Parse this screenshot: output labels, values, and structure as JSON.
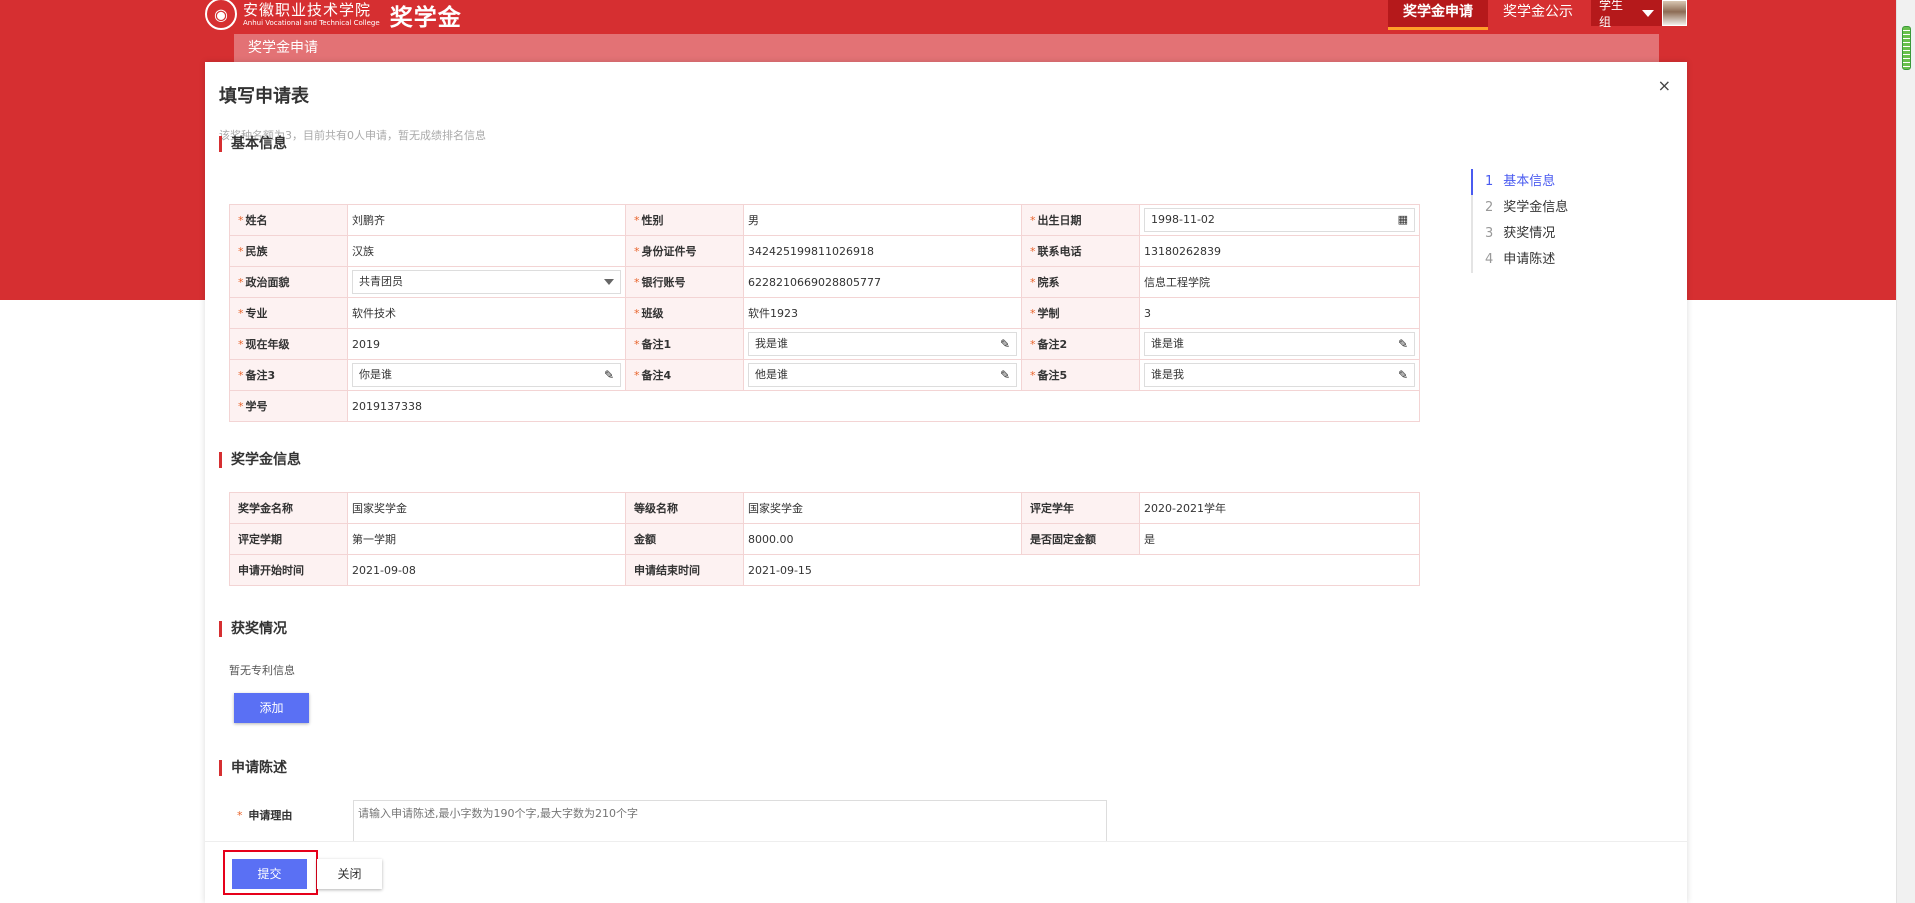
{
  "header": {
    "school_name_cn": "安徽职业技术学院",
    "school_name_en": "Anhui Vocational and Technical College",
    "app_title": "奖学金",
    "nav": [
      {
        "label": "奖学金申请",
        "active": true
      },
      {
        "label": "奖学金公示",
        "active": false
      }
    ],
    "user_name": "学生组"
  },
  "subheader": "奖学金申请",
  "modal": {
    "title": "填写申请表",
    "close": "×",
    "hint": "该奖种名额为3，目前共有0人申请，暂无成绩排名信息"
  },
  "basic": {
    "section_title": "基本信息",
    "name_label": "姓名",
    "name": "刘鹏齐",
    "gender_label": "性别",
    "gender": "男",
    "birth_label": "出生日期",
    "birth": "1998-11-02",
    "ethnic_label": "民族",
    "ethnic": "汉族",
    "idno_label": "身份证件号",
    "idno": "342425199811026918",
    "phone_label": "联系电话",
    "phone": "13180262839",
    "political_label": "政治面貌",
    "political": "共青团员",
    "bank_label": "银行账号",
    "bank": "6228210669028805777",
    "dept_label": "院系",
    "dept": "信息工程学院",
    "major_label": "专业",
    "major": "软件技术",
    "class_label": "班级",
    "class": "软件1923",
    "length_label": "学制",
    "length": "3",
    "grade_label": "现在年级",
    "grade": "2019",
    "note1_label": "备注1",
    "note1": "我是谁",
    "note2_label": "备注2",
    "note2": "谁是谁",
    "note3_label": "备注3",
    "note3": "你是谁",
    "note4_label": "备注4",
    "note4": "他是谁",
    "note5_label": "备注5",
    "note5": "谁是我",
    "sid_label": "学号",
    "sid": "2019137338"
  },
  "scholarship": {
    "section_title": "奖学金信息",
    "name_label": "奖学金名称",
    "name": "国家奖学金",
    "level_label": "等级名称",
    "level": "国家奖学金",
    "year_label": "评定学年",
    "year": "2020-2021学年",
    "term_label": "评定学期",
    "term": "第一学期",
    "amount_label": "金额",
    "amount": "8000.00",
    "fixed_label": "是否固定金额",
    "fixed": "是",
    "start_label": "申请开始时间",
    "start": "2021-09-08",
    "end_label": "申请结束时间",
    "end": "2021-09-15"
  },
  "awards": {
    "section_title": "获奖情况",
    "empty_text": "暂无专利信息",
    "add_button": "添加"
  },
  "statement": {
    "section_title": "申请陈述",
    "reason_label": "申请理由",
    "reason_placeholder": "请输入申请陈述,最小字数为190个字,最大字数为210个字"
  },
  "footer": {
    "submit": "提交",
    "close": "关闭"
  },
  "steps": [
    {
      "num": "1",
      "label": "基本信息",
      "active": true
    },
    {
      "num": "2",
      "label": "奖学金信息",
      "active": false
    },
    {
      "num": "3",
      "label": "获奖情况",
      "active": false
    },
    {
      "num": "4",
      "label": "申请陈述",
      "active": false
    }
  ],
  "colors": {
    "brand_red": "#d62f31",
    "accent_blue": "#5a70f4",
    "highlight_red": "#e6001a"
  }
}
